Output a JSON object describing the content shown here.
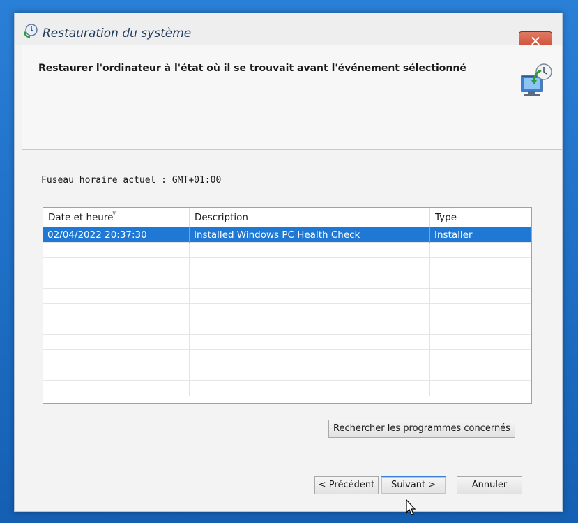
{
  "window": {
    "title": "Restauration du système",
    "close_label": "✕"
  },
  "header": {
    "heading": "Restaurer l'ordinateur à l'état où il se trouvait avant l'événement sélectionné"
  },
  "timezone_text": "Fuseau horaire actuel : GMT+01:00",
  "table": {
    "columns": [
      "Date et heure",
      "Description",
      "Type"
    ],
    "rows": [
      {
        "date": "02/04/2022 20:37:30",
        "description": "Installed Windows PC Health Check",
        "type": "Installer",
        "selected": true
      }
    ]
  },
  "buttons": {
    "scan": "Rechercher les programmes concernés",
    "back": "< Précédent",
    "next": "Suivant >",
    "cancel": "Annuler"
  },
  "icons": {
    "title_icon": "system-restore-icon",
    "header_icon": "restore-monitor-icon",
    "cursor": "mouse-pointer-icon"
  }
}
